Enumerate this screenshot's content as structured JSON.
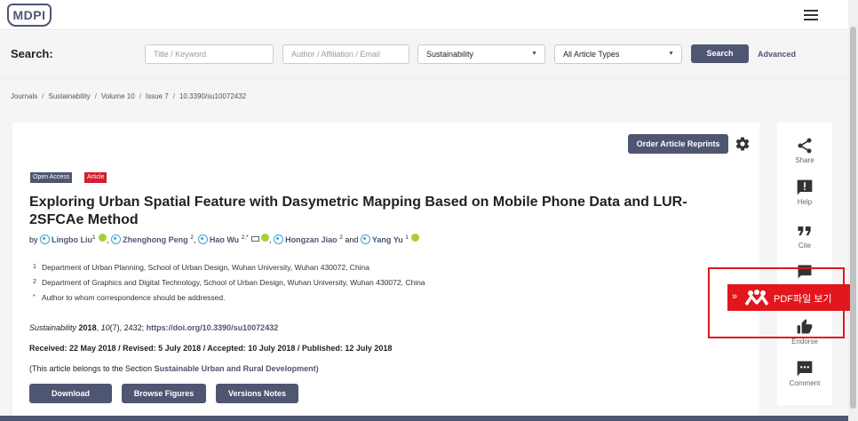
{
  "header": {
    "logo_text": "MDPI"
  },
  "search": {
    "label": "Search:",
    "title_placeholder": "Title / Keyword",
    "author_placeholder": "Author / Affiliation / Email",
    "journal_select": "Sustainability",
    "type_select": "All Article Types",
    "button": "Search",
    "advanced": "Advanced"
  },
  "breadcrumb": [
    "Journals",
    "Sustainability",
    "Volume 10",
    "Issue 7",
    "10.3390/su10072432"
  ],
  "article": {
    "reprints_button": "Order Article Reprints",
    "badges": {
      "open_access": "Open Access",
      "type": "Article"
    },
    "title": "Exploring Urban Spatial Feature with Dasymetric Mapping Based on Mobile Phone Data and LUR-2SFCAe Method",
    "by": "by",
    "authors": [
      {
        "name": "Lingbo Liu",
        "sup": "1",
        "after": ", "
      },
      {
        "name": "Zhenghong Peng",
        "sup": "2",
        "after": ", "
      },
      {
        "name": "Hao Wu",
        "sup": "2,*",
        "after": ", "
      },
      {
        "name": "Hongzan Jiao",
        "sup": "2",
        "after": " and "
      },
      {
        "name": "Yang Yu",
        "sup": "1",
        "after": ""
      }
    ],
    "affiliations": [
      {
        "mark": "1",
        "text": "Department of Urban Planning, School of Urban Design, Wuhan University, Wuhan 430072, China"
      },
      {
        "mark": "2",
        "text": "Department of Graphics and Digital Technology, School of Urban Design, Wuhan University, Wuhan 430072, China"
      },
      {
        "mark": "*",
        "text": "Author to whom correspondence should be addressed."
      }
    ],
    "citation": {
      "journal": "Sustainability",
      "year": "2018",
      "volume": "10",
      "rest": "(7), 2432; ",
      "doi": "https://doi.org/10.3390/su10072432"
    },
    "dates": "Received: 22 May 2018 / Revised: 5 July 2018 / Accepted: 10 July 2018 / Published: 12 July 2018",
    "section_note": {
      "prefix": "(This article belongs to the Section ",
      "section": "Sustainable Urban and Rural Development",
      "suffix": ")"
    },
    "buttons": {
      "download": "Download",
      "browse": "Browse Figures",
      "versions": "Versions Notes"
    }
  },
  "rail": {
    "share": "Share",
    "help": "Help",
    "cite": "Cite",
    "endorse": "Endorse",
    "comment": "Comment"
  },
  "pdf_overlay": {
    "label": "PDF파일 보기",
    "chevron": "»"
  },
  "colors": {
    "brand": "#4f5671",
    "accent_red": "#d21e2d",
    "overlay_red": "#e2161c",
    "orcid_green": "#a6ce39",
    "author_icon": "#35a6d6"
  }
}
